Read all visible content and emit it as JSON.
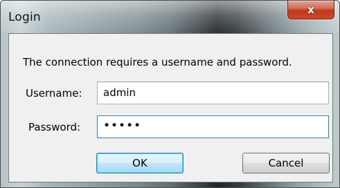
{
  "window": {
    "title": "Login",
    "close_glyph": "x",
    "close_icon": "close-icon"
  },
  "dialog": {
    "message": "The connection requires a username and password.",
    "username_label": "Username:",
    "username_value": "admin",
    "password_label": "Password:",
    "password_value": "•••••",
    "ok_label": "OK",
    "cancel_label": "Cancel"
  }
}
